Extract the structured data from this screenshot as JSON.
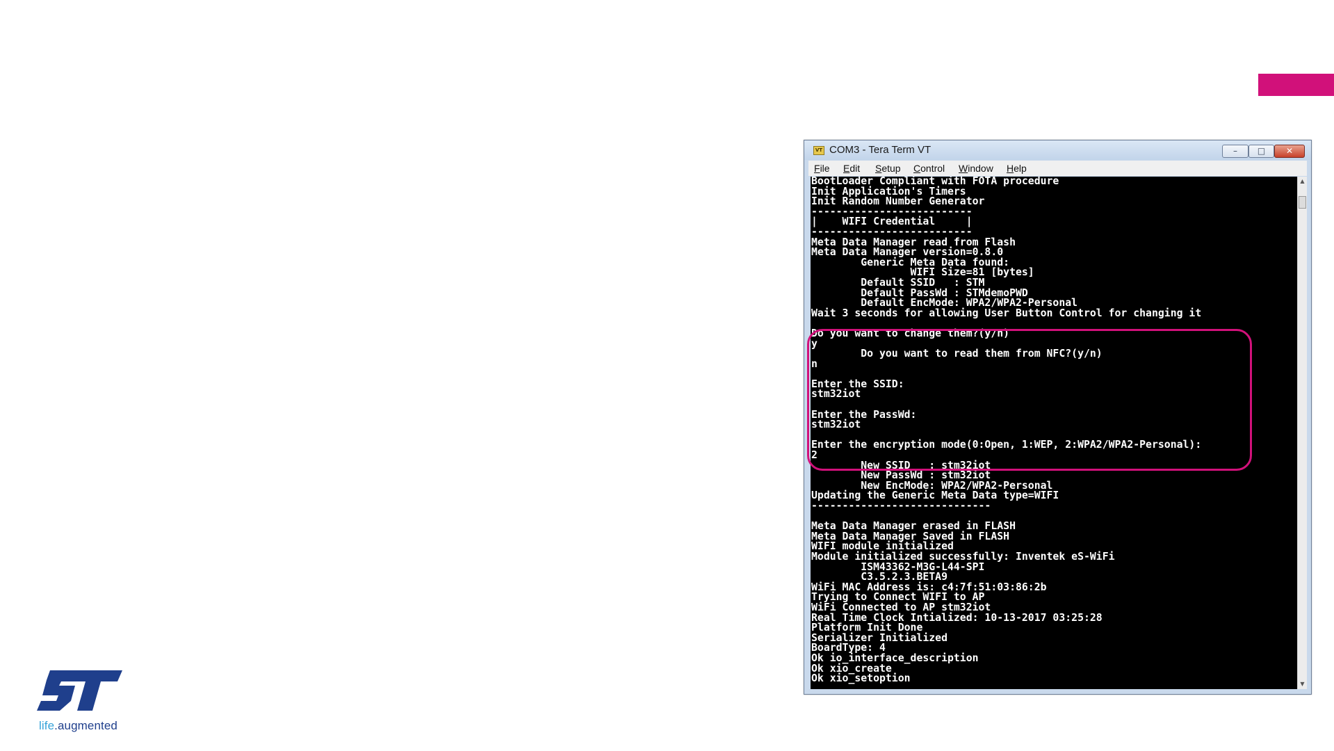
{
  "colors": {
    "accent": "#d1117a",
    "terminal_bg": "#000000",
    "terminal_fg": "#ffffff",
    "logo_blue": "#1f3f8c",
    "logo_light_blue": "#36a3d9"
  },
  "logo": {
    "tagline_life": "life",
    "tagline_rest": ".augmented"
  },
  "window": {
    "icon": "VT",
    "title": "COM3 - Tera Term VT",
    "controls": {
      "minimize": "–",
      "maximize": "□",
      "close": "✕"
    },
    "menu": [
      {
        "underline": "F",
        "rest": "ile"
      },
      {
        "underline": "E",
        "rest": "dit"
      },
      {
        "underline": "S",
        "rest": "etup"
      },
      {
        "underline": "C",
        "rest": "ontrol"
      },
      {
        "underline": "W",
        "rest": "indow"
      },
      {
        "underline": "H",
        "rest": "elp"
      }
    ]
  },
  "terminal": {
    "lines": [
      "BootLoader Compliant with FOTA procedure",
      "Init Application's Timers",
      "Init Random Number Generator",
      "--------------------------",
      "|    WIFI Credential     |",
      "--------------------------",
      "Meta Data Manager read from Flash",
      "Meta Data Manager version=0.8.0",
      "        Generic Meta Data found:",
      "                WIFI Size=81 [bytes]",
      "        Default SSID   : STM",
      "        Default PassWd : STMdemoPWD",
      "        Default EncMode: WPA2/WPA2-Personal",
      "Wait 3 seconds for allowing User Button Control for changing it",
      "",
      "Do you want to change them?(y/n)",
      "y",
      "        Do you want to read them from NFC?(y/n)",
      "n",
      "",
      "Enter the SSID:",
      "stm32iot",
      "",
      "Enter the PassWd:",
      "stm32iot",
      "",
      "Enter the encryption mode(0:Open, 1:WEP, 2:WPA2/WPA2-Personal):",
      "2",
      "        New SSID   : stm32iot",
      "        New PassWd : stm32iot",
      "        New EncMode: WPA2/WPA2-Personal",
      "Updating the Generic Meta Data type=WIFI",
      "-----------------------------",
      "",
      "Meta Data Manager erased in FLASH",
      "Meta Data Manager Saved in FLASH",
      "WIFI module initialized",
      "Module initialized successfully: Inventek eS-WiFi",
      "        ISM43362-M3G-L44-SPI",
      "        C3.5.2.3.BETA9",
      "WiFi MAC Address is: c4:7f:51:03:86:2b",
      "Trying to Connect WIFI to AP",
      "WiFi Connected to AP stm32iot",
      "Real Time Clock Intialized: 10-13-2017 03:25:28",
      "Platform Init Done",
      "Serializer Initialized",
      "BoardType: 4",
      "Ok io_interface_description",
      "Ok xio_create",
      "Ok xio_setoption"
    ]
  },
  "scrollbar": {
    "up": "▲",
    "down": "▼"
  }
}
